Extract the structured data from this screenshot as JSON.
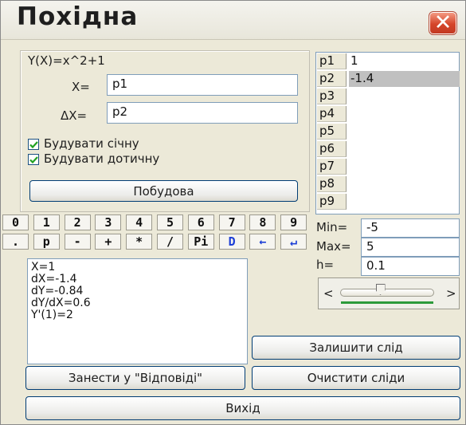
{
  "window": {
    "title": "Похідна",
    "close_symbol": "✕"
  },
  "function_panel": {
    "formula": "Y(X)=x^2+1",
    "x_label": "X=",
    "x_value": "p1",
    "dx_label": "ΔX=",
    "dx_value": "p2",
    "chk_secant_label": "Будувати січну",
    "chk_tangent_label": "Будувати дотичну",
    "chk_secant_checked": true,
    "chk_tangent_checked": true,
    "build_button": "Побудова"
  },
  "params": [
    {
      "name": "p1",
      "value": "1",
      "selected": false
    },
    {
      "name": "p2",
      "value": "-1.4",
      "selected": true
    },
    {
      "name": "p3",
      "value": "",
      "selected": false
    },
    {
      "name": "p4",
      "value": "",
      "selected": false
    },
    {
      "name": "p5",
      "value": "",
      "selected": false
    },
    {
      "name": "p6",
      "value": "",
      "selected": false
    },
    {
      "name": "p7",
      "value": "",
      "selected": false
    },
    {
      "name": "p8",
      "value": "",
      "selected": false
    },
    {
      "name": "p9",
      "value": "",
      "selected": false
    }
  ],
  "keypad": {
    "row1": [
      "0",
      "1",
      "2",
      "3",
      "4",
      "5",
      "6",
      "7",
      "8",
      "9"
    ],
    "row2": [
      ".",
      "p",
      "-",
      "+",
      "*",
      "/",
      "Pi",
      "D",
      "←",
      "↵"
    ]
  },
  "range": {
    "min_label": "Min=",
    "min_value": "-5",
    "max_label": "Max=",
    "max_value": "5",
    "h_label": "h=",
    "h_value": "0.1",
    "left_arrow": "<",
    "right_arrow": ">",
    "slider_position": 0.42
  },
  "output_lines": [
    "X=1",
    "dX=-1.4",
    "dY=-0.84",
    "dY/dX=0.6",
    "Y'(1)=2"
  ],
  "buttons": {
    "trace": "Залишити слід",
    "to_answers": "Занести у \"Відповіді\"",
    "clear_traces": "Очистити сліди",
    "exit": "Вихід"
  },
  "colors": {
    "accent_blue": "#1d3fd6",
    "close_red": "#d5452a",
    "check_green": "#21a121"
  }
}
